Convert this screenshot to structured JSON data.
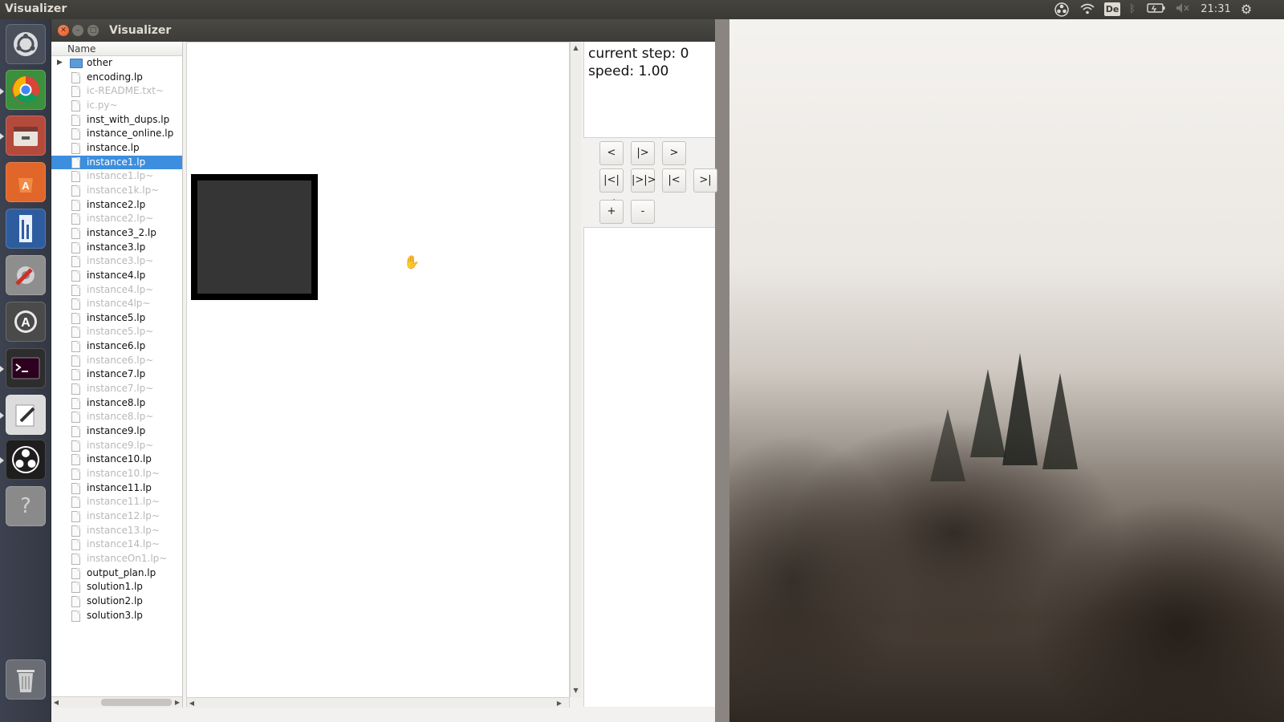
{
  "top_panel": {
    "title": "Visualizer",
    "keyboard_layout": "De",
    "clock": "21:31"
  },
  "launcher": {
    "items": [
      {
        "name": "ubuntu-home-icon",
        "color": "#4a4f5c"
      },
      {
        "name": "chrome-icon",
        "color": "#3c8f3c"
      },
      {
        "name": "file-manager-icon",
        "color": "#b34a3c"
      },
      {
        "name": "software-center-icon",
        "color": "#e0662a"
      },
      {
        "name": "libreoffice-icon",
        "color": "#2e5d9f"
      },
      {
        "name": "system-settings-icon",
        "color": "#8e8e8e"
      },
      {
        "name": "software-updater-icon",
        "color": "#4a4a4a"
      },
      {
        "name": "terminal-icon",
        "color": "#2d2d2d"
      },
      {
        "name": "text-editor-icon",
        "color": "#dcdcdc"
      },
      {
        "name": "obs-icon",
        "color": "#1e1e1e"
      },
      {
        "name": "help-icon",
        "color": "#8a8a8a"
      },
      {
        "name": "trash-icon",
        "color": "#6a6d74"
      }
    ]
  },
  "window": {
    "title": "Visualizer"
  },
  "file_tree": {
    "header": "Name",
    "folder": "other",
    "files": [
      {
        "name": "encoding.lp",
        "dim": false,
        "selected": false
      },
      {
        "name": "ic-README.txt~",
        "dim": true,
        "selected": false
      },
      {
        "name": "ic.py~",
        "dim": true,
        "selected": false
      },
      {
        "name": "inst_with_dups.lp",
        "dim": false,
        "selected": false
      },
      {
        "name": "instance_online.lp",
        "dim": false,
        "selected": false
      },
      {
        "name": "instance.lp",
        "dim": false,
        "selected": false
      },
      {
        "name": "instance1.lp",
        "dim": false,
        "selected": true
      },
      {
        "name": "instance1.lp~",
        "dim": true,
        "selected": false
      },
      {
        "name": "instance1k.lp~",
        "dim": true,
        "selected": false
      },
      {
        "name": "instance2.lp",
        "dim": false,
        "selected": false
      },
      {
        "name": "instance2.lp~",
        "dim": true,
        "selected": false
      },
      {
        "name": "instance3_2.lp",
        "dim": false,
        "selected": false
      },
      {
        "name": "instance3.lp",
        "dim": false,
        "selected": false
      },
      {
        "name": "instance3.lp~",
        "dim": true,
        "selected": false
      },
      {
        "name": "instance4.lp",
        "dim": false,
        "selected": false
      },
      {
        "name": "instance4.lp~",
        "dim": true,
        "selected": false
      },
      {
        "name": "instance4lp~",
        "dim": true,
        "selected": false
      },
      {
        "name": "instance5.lp",
        "dim": false,
        "selected": false
      },
      {
        "name": "instance5.lp~",
        "dim": true,
        "selected": false
      },
      {
        "name": "instance6.lp",
        "dim": false,
        "selected": false
      },
      {
        "name": "instance6.lp~",
        "dim": true,
        "selected": false
      },
      {
        "name": "instance7.lp",
        "dim": false,
        "selected": false
      },
      {
        "name": "instance7.lp~",
        "dim": true,
        "selected": false
      },
      {
        "name": "instance8.lp",
        "dim": false,
        "selected": false
      },
      {
        "name": "instance8.lp~",
        "dim": true,
        "selected": false
      },
      {
        "name": "instance9.lp",
        "dim": false,
        "selected": false
      },
      {
        "name": "instance9.lp~",
        "dim": true,
        "selected": false
      },
      {
        "name": "instance10.lp",
        "dim": false,
        "selected": false
      },
      {
        "name": "instance10.lp~",
        "dim": true,
        "selected": false
      },
      {
        "name": "instance11.lp",
        "dim": false,
        "selected": false
      },
      {
        "name": "instance11.lp~",
        "dim": true,
        "selected": false
      },
      {
        "name": "instance12.lp~",
        "dim": true,
        "selected": false
      },
      {
        "name": "instance13.lp~",
        "dim": true,
        "selected": false
      },
      {
        "name": "instance14.lp~",
        "dim": true,
        "selected": false
      },
      {
        "name": "instanceOn1.lp~",
        "dim": true,
        "selected": false
      },
      {
        "name": "output_plan.lp",
        "dim": false,
        "selected": false
      },
      {
        "name": "solution1.lp",
        "dim": false,
        "selected": false
      },
      {
        "name": "solution2.lp",
        "dim": false,
        "selected": false
      },
      {
        "name": "solution3.lp",
        "dim": false,
        "selected": false
      }
    ]
  },
  "info": {
    "current_step": "current step: 0",
    "speed": "speed: 1.00"
  },
  "controls": {
    "prev": "<",
    "play": "|>",
    "next": ">",
    "rewind_play": "|<|<",
    "fast_play": "|>|>",
    "to_start": "|<",
    "to_end": ">|",
    "plus": "+",
    "minus": "-"
  },
  "colors": {
    "selection": "#3d8ede",
    "close_button": "#e2541e"
  }
}
